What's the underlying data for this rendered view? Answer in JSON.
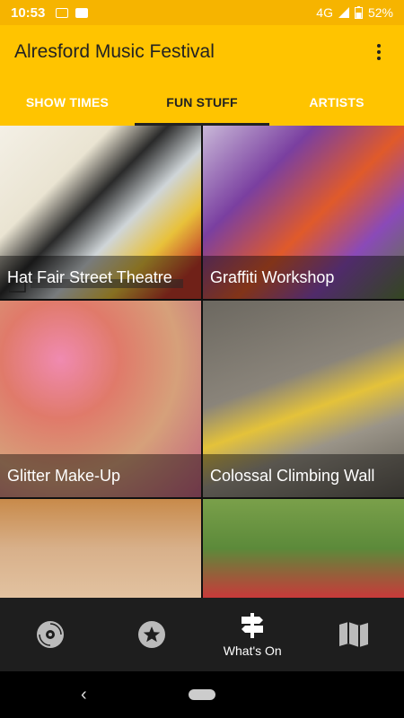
{
  "status_bar": {
    "time": "10:53",
    "network": "4G",
    "battery": "52%"
  },
  "app_bar": {
    "title": "Alresford Music Festival",
    "overflow_icon": "more-vert-icon"
  },
  "tabs": [
    {
      "label": "SHOW TIMES",
      "active": false
    },
    {
      "label": "FUN STUFF",
      "active": true
    },
    {
      "label": "ARTISTS",
      "active": false
    }
  ],
  "tiles": [
    {
      "caption": "Hat Fair Street Theatre"
    },
    {
      "caption": "Graffiti  Workshop"
    },
    {
      "caption": "Glitter Make-Up"
    },
    {
      "caption": "Colossal Climbing Wall"
    },
    {
      "caption": ""
    },
    {
      "caption": ""
    }
  ],
  "bottom_nav": [
    {
      "icon": "vinyl-record-icon",
      "label": ""
    },
    {
      "icon": "star-icon",
      "label": ""
    },
    {
      "icon": "signpost-icon",
      "label": "What's On"
    },
    {
      "icon": "map-icon",
      "label": ""
    }
  ],
  "colors": {
    "status_bar": "#f6b400",
    "primary": "#ffc400",
    "nav_bg": "#1e1e1e"
  }
}
